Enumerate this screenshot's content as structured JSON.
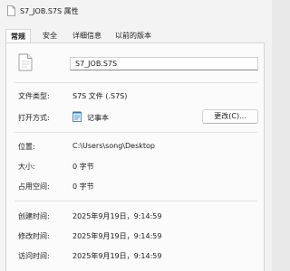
{
  "window": {
    "title": "S7_JOB.S7S 属性"
  },
  "tabs": [
    {
      "label": "常规",
      "active": true
    },
    {
      "label": "安全"
    },
    {
      "label": "详细信息"
    },
    {
      "label": "以前的版本"
    }
  ],
  "general": {
    "file_name": "S7_JOB.S7S",
    "file_type": {
      "label": "文件类型:",
      "value": "S7S 文件 (.S7S)"
    },
    "opens_with": {
      "label": "打开方式:",
      "app": "记事本",
      "change_button": "更改(C)..."
    },
    "location": {
      "label": "位置:",
      "value": "C:\\Users\\song\\Desktop"
    },
    "size": {
      "label": "大小:",
      "value": "0 字节"
    },
    "size_on_disk": {
      "label": "占用空间:",
      "value": "0 字节"
    },
    "created": {
      "label": "创建时间:",
      "value": "2025年9月19日，9:14:59"
    },
    "modified": {
      "label": "修改时间:",
      "value": "2025年9月19日，9:14:59"
    },
    "accessed": {
      "label": "访问时间:",
      "value": "2025年9月19日，9:14:59"
    }
  },
  "icons": {
    "title": "document-icon",
    "file": "document-icon",
    "app": "notepad-icon"
  }
}
